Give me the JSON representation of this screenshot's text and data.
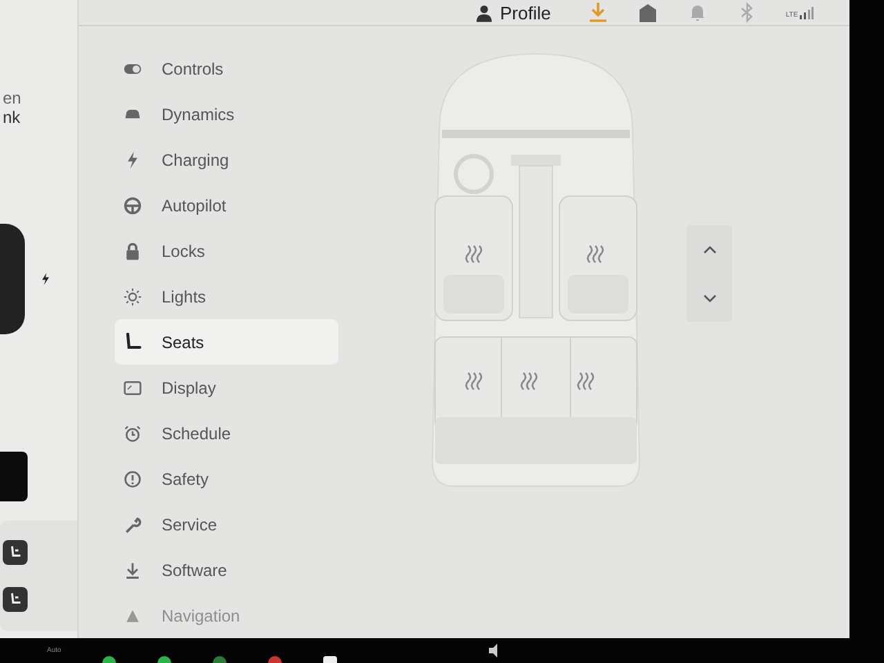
{
  "top_bar": {
    "profile": "Profile",
    "signal_label": "LTE"
  },
  "left_panel": {
    "line_1": "en",
    "line_2": "nk"
  },
  "menu": [
    {
      "label": "Controls",
      "selected": false,
      "faded": false
    },
    {
      "label": "Dynamics",
      "selected": false,
      "faded": false
    },
    {
      "label": "Charging",
      "selected": false,
      "faded": false
    },
    {
      "label": "Autopilot",
      "selected": false,
      "faded": false
    },
    {
      "label": "Locks",
      "selected": false,
      "faded": false
    },
    {
      "label": "Lights",
      "selected": false,
      "faded": false
    },
    {
      "label": "Seats",
      "selected": true,
      "faded": false
    },
    {
      "label": "Display",
      "selected": false,
      "faded": false
    },
    {
      "label": "Schedule",
      "selected": false,
      "faded": false
    },
    {
      "label": "Safety",
      "selected": false,
      "faded": false
    },
    {
      "label": "Service",
      "selected": false,
      "faded": false
    },
    {
      "label": "Software",
      "selected": false,
      "faded": false
    },
    {
      "label": "Navigation",
      "selected": false,
      "faded": true
    }
  ],
  "taskbar": {
    "label": "Auto"
  }
}
